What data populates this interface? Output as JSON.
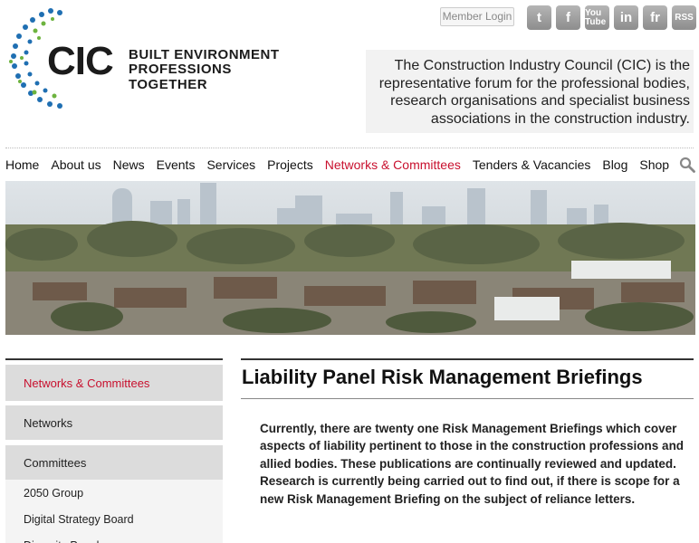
{
  "header": {
    "logo_text": "CIC",
    "tagline_line1": "BUILT ENVIRONMENT",
    "tagline_line2": "PROFESSIONS TOGETHER",
    "member_login": "Member Login",
    "social_icons": [
      "twitter-icon",
      "facebook-icon",
      "youtube-icon",
      "linkedin-icon",
      "french-icon",
      "rss-icon"
    ],
    "social_glyphs": [
      "t",
      "f",
      "You Tube",
      "in",
      "fr",
      "RSS"
    ],
    "intro": "The Construction Industry Council (CIC) is the representative forum for the professional bodies, research organisations and specialist business associations in the construction industry."
  },
  "nav": {
    "items": [
      "Home",
      "About us",
      "News",
      "Events",
      "Services",
      "Projects",
      "Networks & Committees",
      "Tenders & Vacancies",
      "Blog",
      "Shop"
    ],
    "active": "Networks & Committees"
  },
  "sidebar": {
    "items": [
      {
        "label": "Networks & Committees"
      },
      {
        "label": "Networks"
      },
      {
        "label": "Committees"
      }
    ],
    "subitems": [
      "2050 Group",
      "Digital Strategy Board",
      "Diversity Panel"
    ]
  },
  "main": {
    "title": "Liability Panel Risk Management Briefings",
    "body": "Currently, there are twenty one Risk Management Briefings which cover aspects of liability pertinent to those in the construction professions and allied bodies. These publications are continually reviewed and updated. Research is currently being carried out to find out, if there is scope for a new Risk Management Briefing on the subject of reliance letters."
  },
  "colors": {
    "accent": "#c8102e",
    "logo_blue": "#1f6fb2",
    "logo_green": "#6db33f",
    "sidebar_bg": "#dcdcdc"
  }
}
